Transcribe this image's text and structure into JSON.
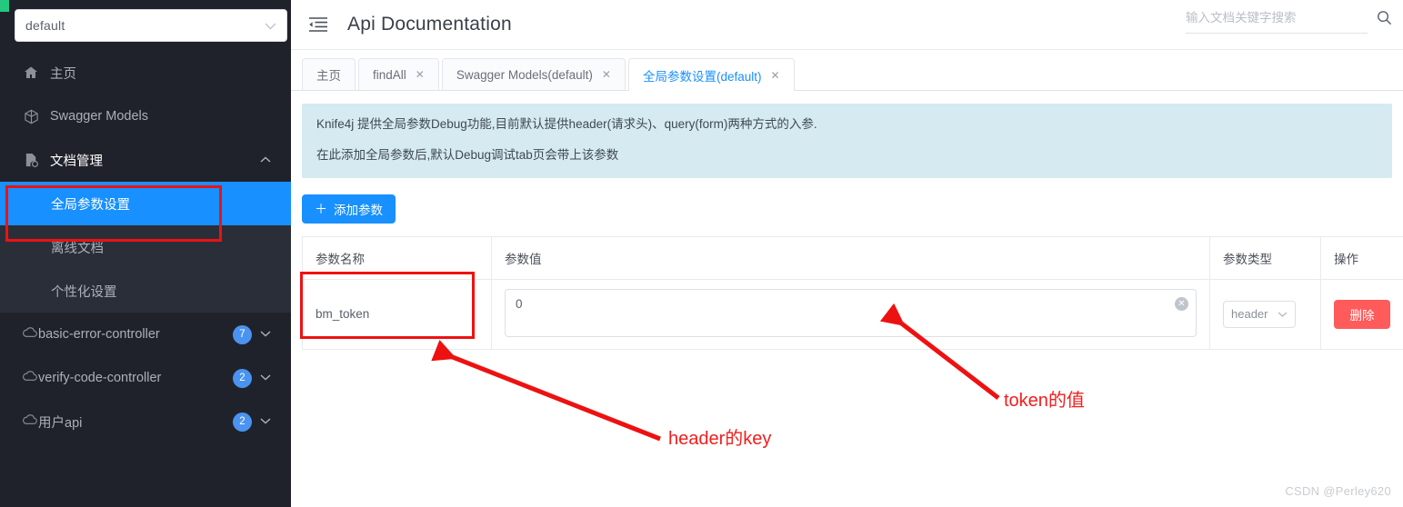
{
  "sidebar": {
    "service_select": {
      "value": "default",
      "caret_icon": "chevron-down-icon"
    },
    "items": [
      {
        "label": "主页",
        "icon": "home-icon"
      },
      {
        "label": "Swagger Models",
        "icon": "cube-icon"
      },
      {
        "label": "文档管理",
        "icon": "document-settings-icon",
        "expanded": true,
        "caret_icon": "chevron-up-icon"
      }
    ],
    "submenu": [
      {
        "label": "全局参数设置",
        "active": true
      },
      {
        "label": "离线文档",
        "active": false
      },
      {
        "label": "个性化设置",
        "active": false
      }
    ],
    "groups": [
      {
        "label": "basic-error-controller",
        "count": "7",
        "icon": "cloud-icon",
        "caret_icon": "chevron-down-icon"
      },
      {
        "label": "verify-code-controller",
        "count": "2",
        "icon": "cloud-icon",
        "caret_icon": "chevron-down-icon"
      },
      {
        "label": "用户api",
        "count": "2",
        "icon": "cloud-icon",
        "caret_icon": "chevron-down-icon"
      }
    ]
  },
  "topbar": {
    "menu_icon": "menu-fold-icon",
    "title": "Api Documentation",
    "search": {
      "placeholder": "输入文档关键字搜索",
      "value": "",
      "icon": "search-icon"
    }
  },
  "tabs": [
    {
      "label": "主页",
      "closable": false,
      "active": false
    },
    {
      "label": "findAll",
      "closable": true,
      "active": false
    },
    {
      "label": "Swagger Models(default)",
      "closable": true,
      "active": false
    },
    {
      "label": "全局参数设置(default)",
      "closable": true,
      "active": true
    }
  ],
  "alert": {
    "line1": "Knife4j 提供全局参数Debug功能,目前默认提供header(请求头)、query(form)两种方式的入参.",
    "line2": "在此添加全局参数后,默认Debug调试tab页会带上该参数"
  },
  "toolbar": {
    "add_label": "添加参数",
    "add_icon": "plus-icon"
  },
  "table": {
    "headers": [
      "参数名称",
      "参数值",
      "参数类型",
      "操作"
    ],
    "rows": [
      {
        "name": "bm_token",
        "value": "0",
        "value_placeholder": "",
        "clear_icon": "circle-close-icon",
        "type": "header",
        "type_caret": "chevron-down-icon",
        "delete_label": "删除"
      }
    ]
  },
  "annotations": {
    "header_key": "header的key",
    "token_value": "token的值",
    "color": "#f41d1d"
  },
  "watermark": "CSDN @Perley620",
  "colors": {
    "sidebar_bg": "#20222b",
    "submenu_bg": "#2a2e39",
    "active_blue": "#1890ff",
    "alert_bg": "#d6eaf2",
    "danger": "#ff5b5b",
    "badge": "#4a93f0",
    "annotation": "#ee1111"
  }
}
